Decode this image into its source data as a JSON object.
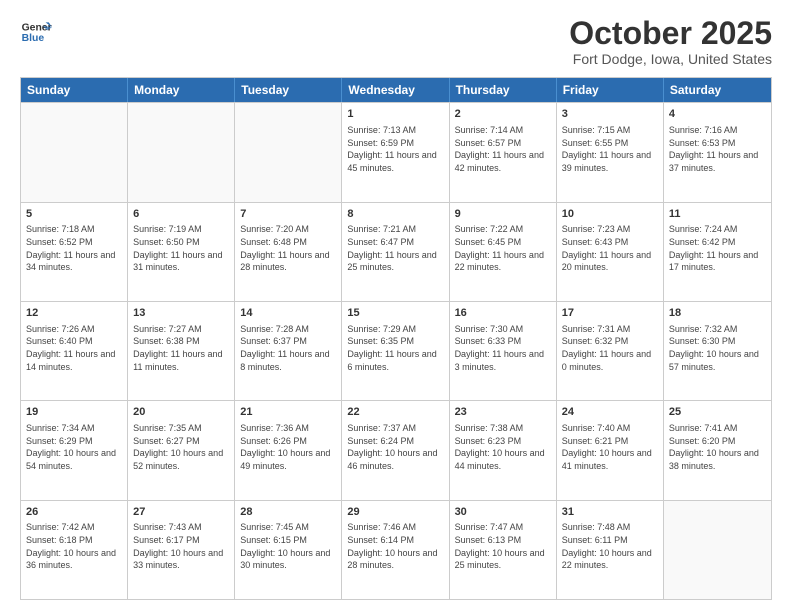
{
  "header": {
    "logo_line1": "General",
    "logo_line2": "Blue",
    "month_title": "October 2025",
    "location": "Fort Dodge, Iowa, United States"
  },
  "days_of_week": [
    "Sunday",
    "Monday",
    "Tuesday",
    "Wednesday",
    "Thursday",
    "Friday",
    "Saturday"
  ],
  "rows": [
    [
      {
        "day": "",
        "info": ""
      },
      {
        "day": "",
        "info": ""
      },
      {
        "day": "",
        "info": ""
      },
      {
        "day": "1",
        "info": "Sunrise: 7:13 AM\nSunset: 6:59 PM\nDaylight: 11 hours\nand 45 minutes."
      },
      {
        "day": "2",
        "info": "Sunrise: 7:14 AM\nSunset: 6:57 PM\nDaylight: 11 hours\nand 42 minutes."
      },
      {
        "day": "3",
        "info": "Sunrise: 7:15 AM\nSunset: 6:55 PM\nDaylight: 11 hours\nand 39 minutes."
      },
      {
        "day": "4",
        "info": "Sunrise: 7:16 AM\nSunset: 6:53 PM\nDaylight: 11 hours\nand 37 minutes."
      }
    ],
    [
      {
        "day": "5",
        "info": "Sunrise: 7:18 AM\nSunset: 6:52 PM\nDaylight: 11 hours\nand 34 minutes."
      },
      {
        "day": "6",
        "info": "Sunrise: 7:19 AM\nSunset: 6:50 PM\nDaylight: 11 hours\nand 31 minutes."
      },
      {
        "day": "7",
        "info": "Sunrise: 7:20 AM\nSunset: 6:48 PM\nDaylight: 11 hours\nand 28 minutes."
      },
      {
        "day": "8",
        "info": "Sunrise: 7:21 AM\nSunset: 6:47 PM\nDaylight: 11 hours\nand 25 minutes."
      },
      {
        "day": "9",
        "info": "Sunrise: 7:22 AM\nSunset: 6:45 PM\nDaylight: 11 hours\nand 22 minutes."
      },
      {
        "day": "10",
        "info": "Sunrise: 7:23 AM\nSunset: 6:43 PM\nDaylight: 11 hours\nand 20 minutes."
      },
      {
        "day": "11",
        "info": "Sunrise: 7:24 AM\nSunset: 6:42 PM\nDaylight: 11 hours\nand 17 minutes."
      }
    ],
    [
      {
        "day": "12",
        "info": "Sunrise: 7:26 AM\nSunset: 6:40 PM\nDaylight: 11 hours\nand 14 minutes."
      },
      {
        "day": "13",
        "info": "Sunrise: 7:27 AM\nSunset: 6:38 PM\nDaylight: 11 hours\nand 11 minutes."
      },
      {
        "day": "14",
        "info": "Sunrise: 7:28 AM\nSunset: 6:37 PM\nDaylight: 11 hours\nand 8 minutes."
      },
      {
        "day": "15",
        "info": "Sunrise: 7:29 AM\nSunset: 6:35 PM\nDaylight: 11 hours\nand 6 minutes."
      },
      {
        "day": "16",
        "info": "Sunrise: 7:30 AM\nSunset: 6:33 PM\nDaylight: 11 hours\nand 3 minutes."
      },
      {
        "day": "17",
        "info": "Sunrise: 7:31 AM\nSunset: 6:32 PM\nDaylight: 11 hours\nand 0 minutes."
      },
      {
        "day": "18",
        "info": "Sunrise: 7:32 AM\nSunset: 6:30 PM\nDaylight: 10 hours\nand 57 minutes."
      }
    ],
    [
      {
        "day": "19",
        "info": "Sunrise: 7:34 AM\nSunset: 6:29 PM\nDaylight: 10 hours\nand 54 minutes."
      },
      {
        "day": "20",
        "info": "Sunrise: 7:35 AM\nSunset: 6:27 PM\nDaylight: 10 hours\nand 52 minutes."
      },
      {
        "day": "21",
        "info": "Sunrise: 7:36 AM\nSunset: 6:26 PM\nDaylight: 10 hours\nand 49 minutes."
      },
      {
        "day": "22",
        "info": "Sunrise: 7:37 AM\nSunset: 6:24 PM\nDaylight: 10 hours\nand 46 minutes."
      },
      {
        "day": "23",
        "info": "Sunrise: 7:38 AM\nSunset: 6:23 PM\nDaylight: 10 hours\nand 44 minutes."
      },
      {
        "day": "24",
        "info": "Sunrise: 7:40 AM\nSunset: 6:21 PM\nDaylight: 10 hours\nand 41 minutes."
      },
      {
        "day": "25",
        "info": "Sunrise: 7:41 AM\nSunset: 6:20 PM\nDaylight: 10 hours\nand 38 minutes."
      }
    ],
    [
      {
        "day": "26",
        "info": "Sunrise: 7:42 AM\nSunset: 6:18 PM\nDaylight: 10 hours\nand 36 minutes."
      },
      {
        "day": "27",
        "info": "Sunrise: 7:43 AM\nSunset: 6:17 PM\nDaylight: 10 hours\nand 33 minutes."
      },
      {
        "day": "28",
        "info": "Sunrise: 7:45 AM\nSunset: 6:15 PM\nDaylight: 10 hours\nand 30 minutes."
      },
      {
        "day": "29",
        "info": "Sunrise: 7:46 AM\nSunset: 6:14 PM\nDaylight: 10 hours\nand 28 minutes."
      },
      {
        "day": "30",
        "info": "Sunrise: 7:47 AM\nSunset: 6:13 PM\nDaylight: 10 hours\nand 25 minutes."
      },
      {
        "day": "31",
        "info": "Sunrise: 7:48 AM\nSunset: 6:11 PM\nDaylight: 10 hours\nand 22 minutes."
      },
      {
        "day": "",
        "info": ""
      }
    ]
  ]
}
